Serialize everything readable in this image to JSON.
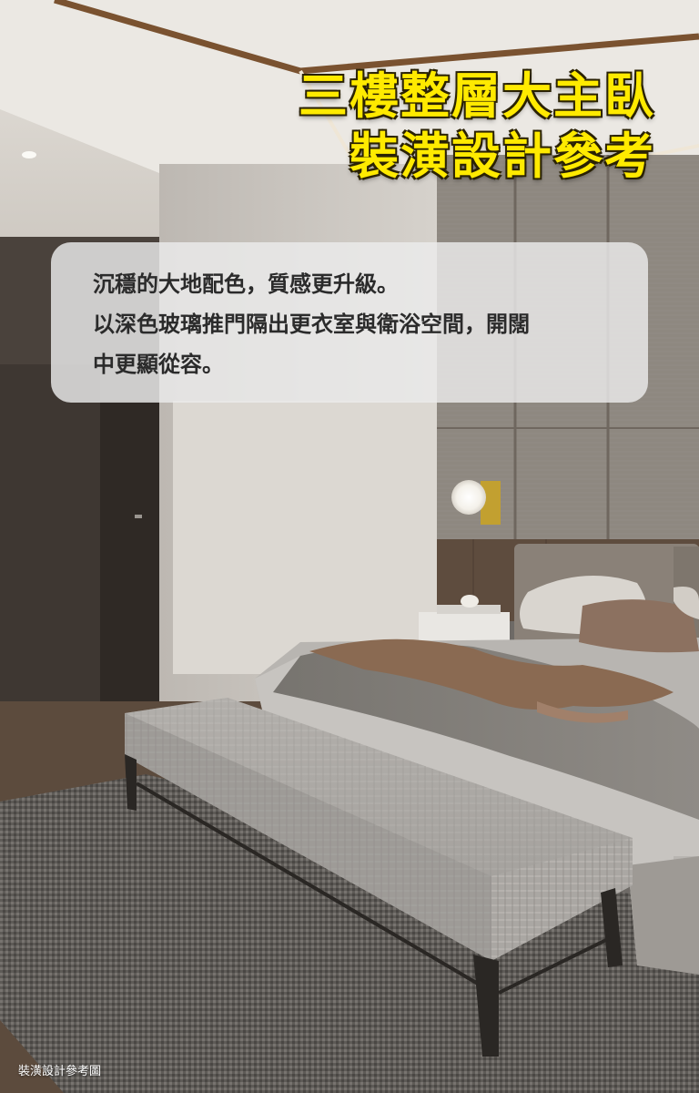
{
  "title": {
    "line1": "三樓整層大主臥",
    "line2": "裝潢設計參考"
  },
  "caption": {
    "line1": "沉穩的大地配色，質感更升級。",
    "line2": "以深色玻璃推門隔出更衣室與衛浴空間，開闊",
    "line3": "中更顯從容。"
  },
  "footnote": "裝潢設計參考圖",
  "colors": {
    "title": "#ffea00",
    "caption_box": "#ececec",
    "caption_text": "#2b2b2b"
  }
}
